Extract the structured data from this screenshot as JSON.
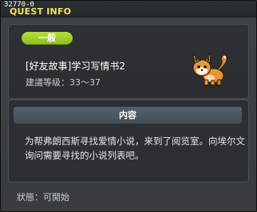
{
  "window": {
    "id": "32770-0",
    "title": "QUEST INFO"
  },
  "quest": {
    "category": "一般",
    "name": "[好友故事]学习写情书2",
    "level_label": "建議等级：",
    "level_range": "33～37",
    "icon": "fox-pet-icon"
  },
  "content": {
    "header": "内容",
    "text": "为帮弗朗西斯寻找爱情小说，来到了阅览室。向埃尔文询问需要寻找的小说列表吧。"
  },
  "status": {
    "label": "狀態：",
    "value": "可開始"
  },
  "colors": {
    "title": "#f0e35a",
    "badge": "#9cc92a"
  }
}
